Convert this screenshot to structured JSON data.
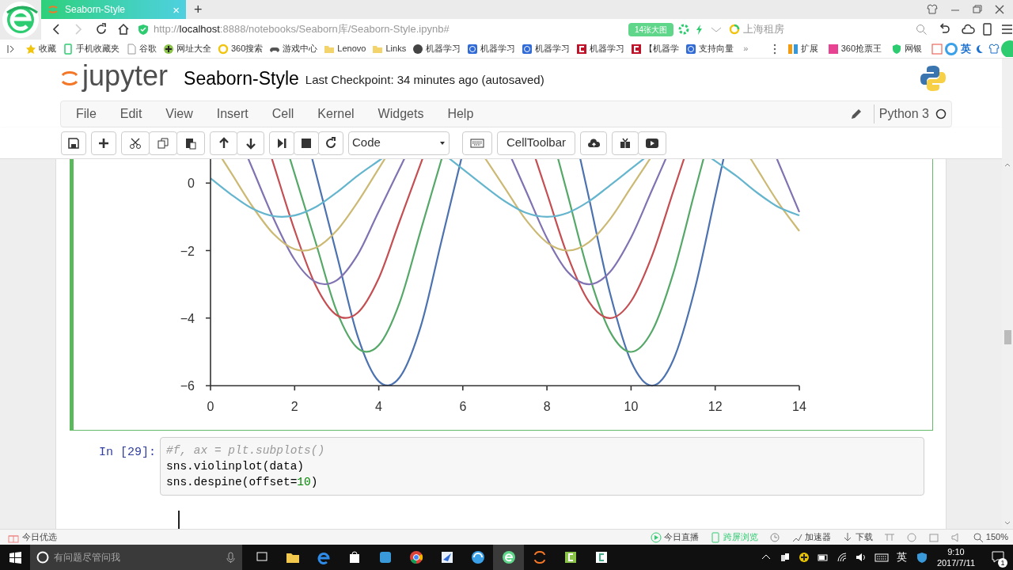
{
  "browser": {
    "tab": {
      "title": "Seaborn-Style",
      "close": "×",
      "selected": true
    },
    "new_tab": "+",
    "address": {
      "scheme": "http://",
      "host": "localhost",
      "rest": ":8888/notebooks/Seaborn库/Seaborn-Style.ipynb#"
    },
    "promo_badge": "14张大图",
    "search": {
      "placeholder": "上海租房"
    }
  },
  "bookmarks": [
    {
      "label": "收藏"
    },
    {
      "label": "手机收藏夹"
    },
    {
      "label": "谷歌"
    },
    {
      "label": "网址大全"
    },
    {
      "label": "360搜索"
    },
    {
      "label": "游戏中心"
    },
    {
      "label": "Lenovo"
    },
    {
      "label": "Links"
    },
    {
      "label": "机器学习"
    },
    {
      "label": "机器学习"
    },
    {
      "label": "机器学习"
    },
    {
      "label": "机器学习"
    },
    {
      "label": "【机器学"
    },
    {
      "label": "支持向量"
    }
  ],
  "bookmarks_more": "»",
  "bookmarks_right": [
    {
      "label": "扩展"
    },
    {
      "label": "360抢票王"
    },
    {
      "label": "网银"
    }
  ],
  "ime_badge": "英",
  "jupyter": {
    "logo_text": "jupyter",
    "notebook_name": "Seaborn-Style",
    "checkpoint": "Last Checkpoint: 34 minutes ago (autosaved)",
    "menu": [
      "File",
      "Edit",
      "View",
      "Insert",
      "Cell",
      "Kernel",
      "Widgets",
      "Help"
    ],
    "kernel": "Python 3",
    "cell_type": "Code",
    "celltoolbar": "CellToolbar"
  },
  "cells": [
    {
      "kind": "output_chart",
      "selected": true,
      "chart_data": {
        "type": "line",
        "xlim": [
          0,
          14
        ],
        "ylim": [
          -6,
          0.66
        ],
        "xticks": [
          0,
          2,
          4,
          6,
          8,
          10,
          12,
          14
        ],
        "yticks": [
          0,
          -2,
          -4,
          -6
        ],
        "x": [
          0,
          0.5,
          1,
          1.5,
          2,
          2.5,
          3,
          3.5,
          4,
          4.5,
          5,
          5.5,
          6,
          6.5,
          7,
          7.5,
          8,
          8.5,
          9,
          9.5,
          10,
          10.5,
          11,
          11.5,
          12,
          12.5,
          13,
          13.5,
          14
        ],
        "series": [
          {
            "color": "#4c72b0",
            "values": [
              null,
              null,
              null,
              null,
              null,
              null,
              -2.11,
              -4.54,
              -5.87,
              -5.75,
              -4.24,
              -1.67,
              null,
              null,
              null,
              null,
              null,
              null,
              -0.45,
              -3.26,
              -5.28,
              -6.0,
              -5.25,
              -3.22,
              -0.4,
              null,
              null,
              null,
              null
            ]
          },
          {
            "color": "#55a868",
            "values": [
              null,
              null,
              null,
              null,
              null,
              -1.76,
              -3.79,
              -4.89,
              -4.8,
              -3.53,
              -1.4,
              null,
              null,
              null,
              null,
              null,
              null,
              -0.38,
              -2.72,
              -4.4,
              -5.0,
              -4.38,
              -2.69,
              -0.33,
              null,
              null,
              null,
              null,
              null
            ]
          },
          {
            "color": "#c44e52",
            "values": [
              null,
              null,
              null,
              0.56,
              -1.4,
              -3.03,
              -3.91,
              -3.84,
              -2.82,
              -1.12,
              null,
              null,
              null,
              null,
              null,
              null,
              -0.3,
              -2.18,
              -3.52,
              -4.0,
              -3.5,
              -2.15,
              -0.26,
              null,
              null,
              null,
              null,
              null,
              null
            ]
          },
          {
            "color": "#8172b2",
            "values": [
              null,
              null,
              0.42,
              -1.05,
              -2.27,
              -2.93,
              -2.88,
              -2.12,
              -0.84,
              null,
              null,
              null,
              null,
              null,
              null,
              -0.23,
              -1.63,
              -2.64,
              -3.0,
              -2.63,
              -1.61,
              -0.2,
              null,
              null,
              null,
              null,
              null,
              0.62,
              -0.86
            ]
          },
          {
            "color": "#ccb974",
            "values": [
              null,
              0.28,
              -0.7,
              -1.51,
              -1.96,
              -1.92,
              -1.41,
              -0.56,
              0.43,
              null,
              null,
              null,
              null,
              null,
              -0.15,
              -1.09,
              -1.76,
              -2.0,
              -1.75,
              -1.07,
              -0.13,
              null,
              null,
              null,
              null,
              null,
              0.41,
              -0.58,
              -1.42
            ]
          },
          {
            "color": "#64b5cd",
            "values": [
              0.14,
              -0.35,
              -0.76,
              -0.98,
              -0.96,
              -0.71,
              -0.28,
              0.22,
              0.66,
              null,
              null,
              null,
              0.41,
              -0.08,
              -0.54,
              -0.88,
              -1.0,
              -0.88,
              -0.54,
              -0.07,
              0.42,
              null,
              null,
              null,
              0.65,
              0.21,
              -0.29,
              -0.71,
              -0.96
            ]
          }
        ]
      }
    },
    {
      "kind": "code",
      "selected": false,
      "prompt": "In [29]:",
      "lines": [
        [
          {
            "kind": "comment",
            "text": "#f, ax = plt.subplots()"
          }
        ],
        [
          {
            "kind": "plain",
            "text": "sns.violinplot(data)"
          }
        ],
        [
          {
            "kind": "plain",
            "text": "sns.despine(offset="
          },
          {
            "kind": "number",
            "text": "10"
          },
          {
            "kind": "plain",
            "text": ")"
          }
        ]
      ]
    }
  ],
  "status_bar": {
    "left": "今日优选",
    "items": [
      "今日直播",
      "跨屏浏览",
      "加速器",
      "下载"
    ],
    "zoom": "150%"
  },
  "taskbar": {
    "search_placeholder": "有问题尽管问我",
    "ime": "英",
    "time": "9:10",
    "date": "2017/7/11",
    "notifications": "1"
  }
}
